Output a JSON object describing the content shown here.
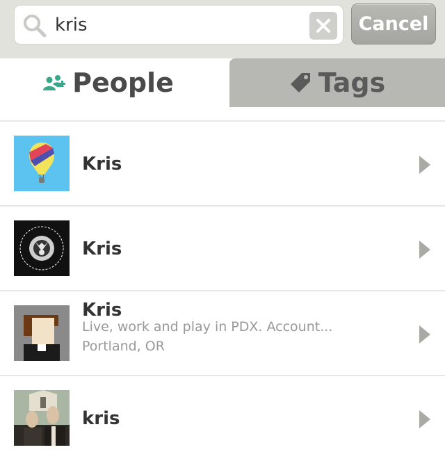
{
  "search": {
    "value": "kris",
    "cancel_label": "Cancel"
  },
  "tabs": [
    {
      "label": "People",
      "icon": "people-icon",
      "active": true
    },
    {
      "label": "Tags",
      "icon": "tag-icon",
      "active": false
    }
  ],
  "results": [
    {
      "name": "Kris",
      "avatar": "hot-air-balloon-avatar"
    },
    {
      "name": "Kris",
      "avatar": "music-badge-avatar"
    },
    {
      "name": "Kris",
      "bio": "Live, work and play in PDX. Account...",
      "location": "Portland, OR",
      "avatar": "pixel-portrait-avatar"
    },
    {
      "name": "kris",
      "avatar": "american-gothic-avatar"
    }
  ],
  "colors": {
    "accent_green": "#3aa78a",
    "topbar_bg": "#e2e2dd",
    "inactive_tab_bg": "#b7b7b3",
    "text_dark": "#333333",
    "text_muted": "#999999"
  }
}
